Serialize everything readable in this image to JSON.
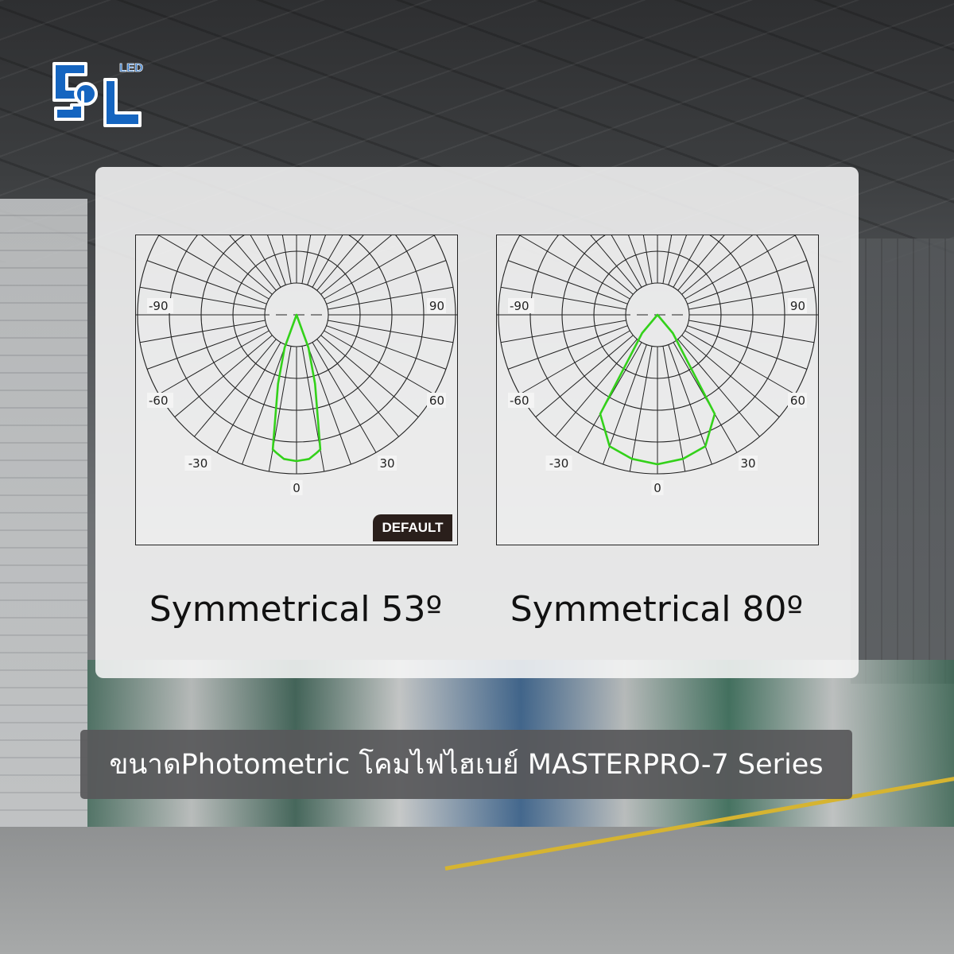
{
  "brand": {
    "logo_text": "LED",
    "colors": {
      "primary": "#1565c0",
      "outline": "#ffffff"
    }
  },
  "banner": {
    "text": "ขนาดPhotometric โคมไฟไฮเบย์ MASTERPRO-7 Series"
  },
  "chart_data": [
    {
      "type": "polar",
      "caption": "Symmetrical 53º",
      "badge": "DEFAULT",
      "angle_labels": [
        "-90",
        "90",
        "-60",
        "60",
        "-30",
        "30",
        "0"
      ],
      "series": [
        {
          "color": "#e53935",
          "points": [
            {
              "angle": -20,
              "r": 0.22
            },
            {
              "angle": -15,
              "r": 0.45
            },
            {
              "angle": -10,
              "r": 0.86
            },
            {
              "angle": -8,
              "r": 0.88
            },
            {
              "angle": -5,
              "r": 0.91
            },
            {
              "angle": 0,
              "r": 0.92
            },
            {
              "angle": 5,
              "r": 0.91
            },
            {
              "angle": 8,
              "r": 0.88
            },
            {
              "angle": 10,
              "r": 0.86
            },
            {
              "angle": 15,
              "r": 0.45
            },
            {
              "angle": 20,
              "r": 0.22
            }
          ]
        },
        {
          "color": "#33d11a",
          "points": [
            {
              "angle": -20,
              "r": 0.22
            },
            {
              "angle": -15,
              "r": 0.45
            },
            {
              "angle": -10,
              "r": 0.86
            },
            {
              "angle": -8,
              "r": 0.88
            },
            {
              "angle": -5,
              "r": 0.91
            },
            {
              "angle": 0,
              "r": 0.92
            },
            {
              "angle": 5,
              "r": 0.91
            },
            {
              "angle": 8,
              "r": 0.88
            },
            {
              "angle": 10,
              "r": 0.86
            },
            {
              "angle": 15,
              "r": 0.45
            },
            {
              "angle": 20,
              "r": 0.22
            }
          ]
        }
      ]
    },
    {
      "type": "polar",
      "caption": "Symmetrical 80º",
      "angle_labels": [
        "-90",
        "90",
        "-60",
        "60",
        "-30",
        "30",
        "0"
      ],
      "series": [
        {
          "color": "#33d11a",
          "points": [
            {
              "angle": -40,
              "r": 0.15
            },
            {
              "angle": -30,
              "r": 0.72
            },
            {
              "angle": -20,
              "r": 0.88
            },
            {
              "angle": -10,
              "r": 0.92
            },
            {
              "angle": 0,
              "r": 0.94
            },
            {
              "angle": 10,
              "r": 0.92
            },
            {
              "angle": 20,
              "r": 0.88
            },
            {
              "angle": 30,
              "r": 0.72
            },
            {
              "angle": 40,
              "r": 0.15
            }
          ]
        }
      ]
    }
  ]
}
